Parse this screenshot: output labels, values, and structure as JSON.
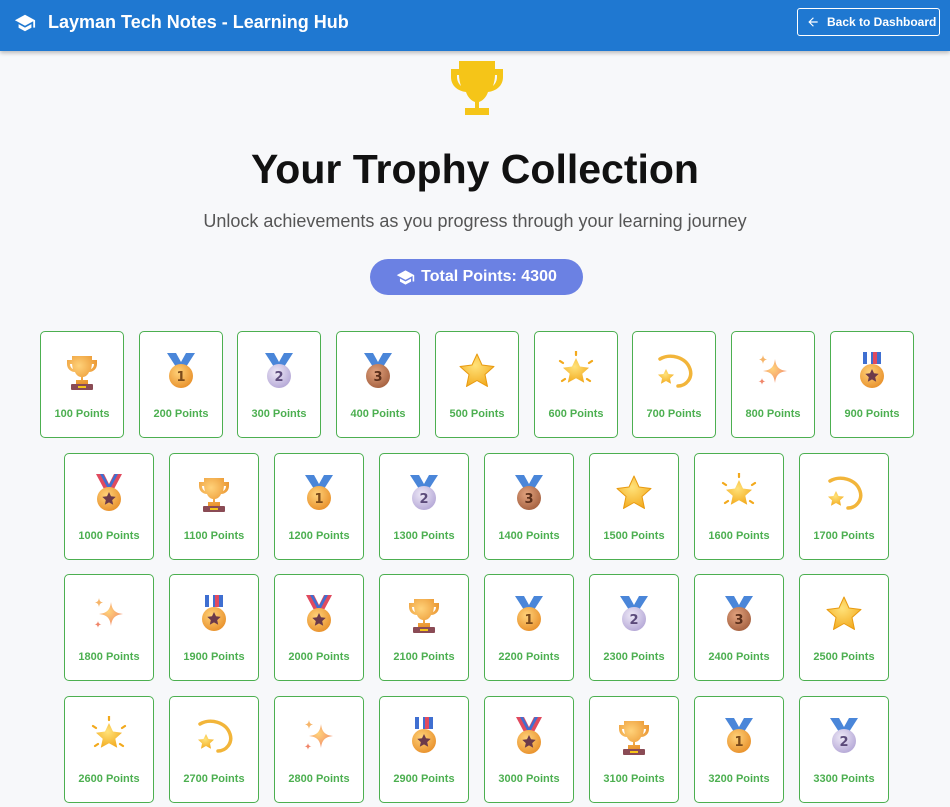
{
  "header": {
    "title": "Layman Tech Notes - Learning Hub",
    "back_label": "Back to Dashboard"
  },
  "hero": {
    "title": "Your Trophy Collection",
    "subtitle": "Unlock achievements as you progress through your learning journey",
    "total_points": "Total Points: 4300"
  },
  "trophies": [
    {
      "label": "100 Points",
      "icon": "trophy-icon"
    },
    {
      "label": "200 Points",
      "icon": "gold-medal-icon"
    },
    {
      "label": "300 Points",
      "icon": "silver-medal-icon"
    },
    {
      "label": "400 Points",
      "icon": "bronze-medal-icon"
    },
    {
      "label": "500 Points",
      "icon": "star-icon"
    },
    {
      "label": "600 Points",
      "icon": "glowing-star-icon"
    },
    {
      "label": "700 Points",
      "icon": "dizzy-icon"
    },
    {
      "label": "800 Points",
      "icon": "sparkles-icon"
    },
    {
      "label": "900 Points",
      "icon": "military-medal-icon"
    },
    {
      "label": "1000 Points",
      "icon": "sports-medal-icon"
    },
    {
      "label": "1100 Points",
      "icon": "trophy-icon"
    },
    {
      "label": "1200 Points",
      "icon": "gold-medal-icon"
    },
    {
      "label": "1300 Points",
      "icon": "silver-medal-icon"
    },
    {
      "label": "1400 Points",
      "icon": "bronze-medal-icon"
    },
    {
      "label": "1500 Points",
      "icon": "star-icon"
    },
    {
      "label": "1600 Points",
      "icon": "glowing-star-icon"
    },
    {
      "label": "1700 Points",
      "icon": "dizzy-icon"
    },
    {
      "label": "1800 Points",
      "icon": "sparkles-icon"
    },
    {
      "label": "1900 Points",
      "icon": "military-medal-icon"
    },
    {
      "label": "2000 Points",
      "icon": "sports-medal-icon"
    },
    {
      "label": "2100 Points",
      "icon": "trophy-icon"
    },
    {
      "label": "2200 Points",
      "icon": "gold-medal-icon"
    },
    {
      "label": "2300 Points",
      "icon": "silver-medal-icon"
    },
    {
      "label": "2400 Points",
      "icon": "bronze-medal-icon"
    },
    {
      "label": "2500 Points",
      "icon": "star-icon"
    },
    {
      "label": "2600 Points",
      "icon": "glowing-star-icon"
    },
    {
      "label": "2700 Points",
      "icon": "dizzy-icon"
    },
    {
      "label": "2800 Points",
      "icon": "sparkles-icon"
    },
    {
      "label": "2900 Points",
      "icon": "military-medal-icon"
    },
    {
      "label": "3000 Points",
      "icon": "sports-medal-icon"
    },
    {
      "label": "3100 Points",
      "icon": "trophy-icon"
    },
    {
      "label": "3200 Points",
      "icon": "gold-medal-icon"
    },
    {
      "label": "3300 Points",
      "icon": "silver-medal-icon"
    }
  ],
  "colors": {
    "header_bg": "#1f78d1",
    "card_border": "#4caf50",
    "pill_bg": "#6b81e3",
    "trophy_gold": "#f5c518"
  }
}
